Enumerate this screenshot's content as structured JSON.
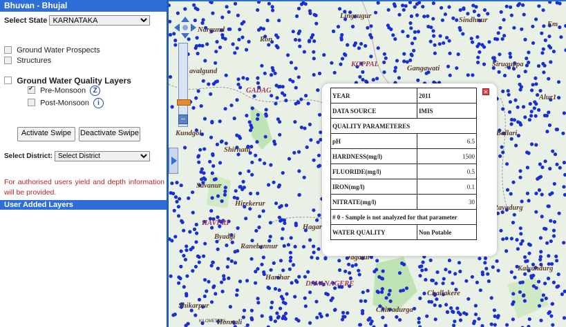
{
  "sidebar": {
    "title": "Bhuvan - Bhujal",
    "select_state_label": "Select State",
    "select_state_value": "KARNATAKA",
    "layers": {
      "ground_water_prospects": "Ground Water Prospects",
      "structures": "Structures",
      "quality_group_label": "Ground Water Quality Layers",
      "pre_monsoon": "Pre-Monsoon",
      "post_monsoon": "Post-Monsoon",
      "pre_checked": true,
      "post_checked": false
    },
    "activate_swipe": "Activate Swipe",
    "deactivate_swipe": "Deactivate Swipe",
    "select_district_label": "Select District:",
    "select_district_value": "Select District",
    "note": "For authorised users yield and depth information will be provided.",
    "user_added_layers": "User Added Layers"
  },
  "map": {
    "labels": [
      {
        "text": "Lingsugur"
      },
      {
        "text": "Sindhnur"
      },
      {
        "text": "Em"
      },
      {
        "text": "Nargund"
      },
      {
        "text": "Ron"
      },
      {
        "text": "KOPPAL"
      },
      {
        "text": "Gangawati"
      },
      {
        "text": "Siruguppa"
      },
      {
        "text": "avalgund"
      },
      {
        "text": "GADAG"
      },
      {
        "text": "Alur1"
      },
      {
        "text": "Kundgol"
      },
      {
        "text": "Shirhatti"
      },
      {
        "text": "Savanur"
      },
      {
        "text": "Hirekerur"
      },
      {
        "text": "HAVERI"
      },
      {
        "text": "Ranebennur"
      },
      {
        "text": "Hagari"
      },
      {
        "text": "Jagalur"
      },
      {
        "text": "Harihar"
      },
      {
        "text": "DAVANAGERE"
      },
      {
        "text": "Challakere"
      },
      {
        "text": "Chitradurga"
      },
      {
        "text": "Ballari"
      },
      {
        "text": "Rayadurg"
      },
      {
        "text": "Kalyandurg"
      },
      {
        "text": "Honnali"
      },
      {
        "text": "Shikarpur"
      },
      {
        "text": "Byadgi"
      }
    ],
    "scale_text": "KILOMETERS"
  },
  "popup": {
    "rows": [
      {
        "label": "YEAR",
        "value": "2011"
      },
      {
        "label": "DATA SOURCE",
        "value": "IMIS"
      }
    ],
    "quality_heading": "QUALITY PARAMETERES",
    "params": [
      {
        "label": "pH",
        "value": "6.5"
      },
      {
        "label": "HARDNESS(mg/l)",
        "value": "1500"
      },
      {
        "label": "FLUORIDE(mg/l)",
        "value": "0.5"
      },
      {
        "label": "IRON(mg/l)",
        "value": "0.1"
      },
      {
        "label": "NITRATE(mg/l)",
        "value": "30"
      }
    ],
    "footnote": "# 0 - Sample is not analyzed for that parameter",
    "water_quality_label": "WATER QUALITY",
    "water_quality_value": "Non Potable"
  },
  "colors": {
    "panel_blue": "#2d6fd6",
    "dot_blue": "#1a2fd0",
    "map_bg": "#e9f1e7",
    "note_red": "#b22222"
  },
  "icons": [
    "pan-icon",
    "zoom-in-icon",
    "zoom-out-icon",
    "info-circle-icon",
    "close-icon"
  ]
}
